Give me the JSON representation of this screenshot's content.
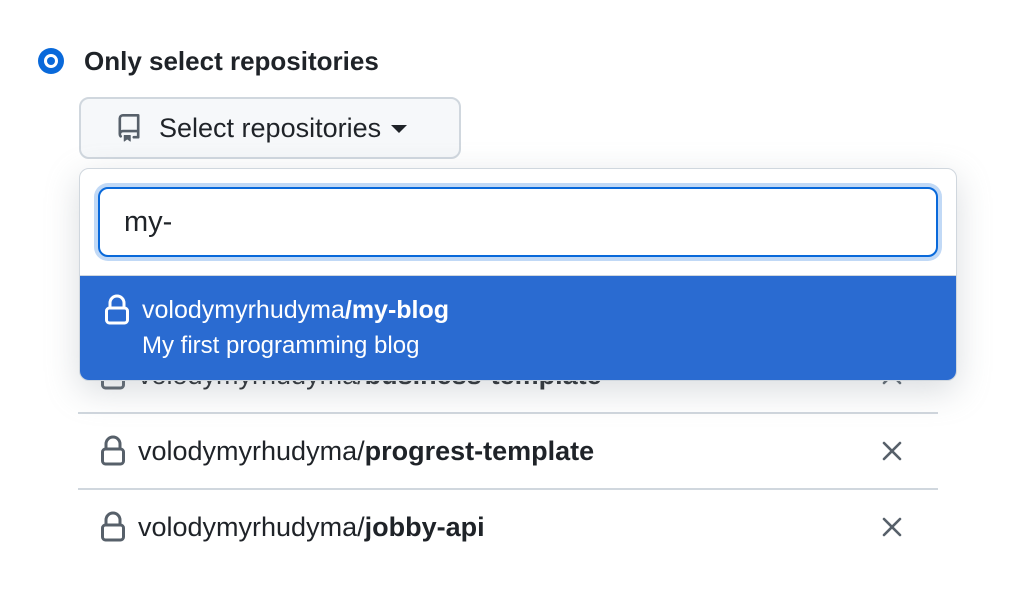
{
  "radio": {
    "label": "Only select repositories",
    "checked": true,
    "color": "#0969da"
  },
  "select_button": {
    "label": "Select repositories",
    "icon": "repo-icon"
  },
  "dropdown": {
    "search": {
      "value": "my-",
      "placeholder": ""
    },
    "results": [
      {
        "owner": "volodymyrhudyma",
        "separator": "/",
        "name": "my-blog",
        "description": "My first programming blog",
        "icon": "lock-icon",
        "highlighted": true
      }
    ],
    "highlight_color": "#2a6bd1"
  },
  "selected_repos": [
    {
      "owner": "volodymyrhudyma",
      "separator": "/",
      "name": "business-template"
    },
    {
      "owner": "volodymyrhudyma",
      "separator": "/",
      "name": "progrest-template"
    },
    {
      "owner": "volodymyrhudyma",
      "separator": "/",
      "name": "jobby-api"
    }
  ]
}
